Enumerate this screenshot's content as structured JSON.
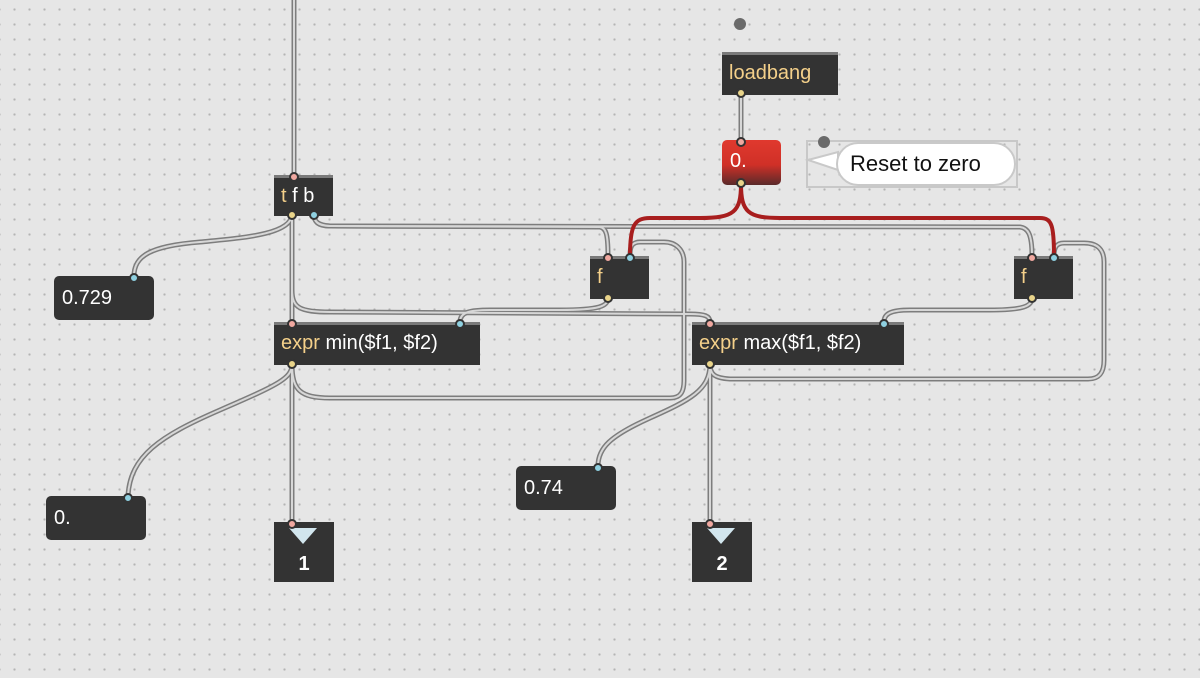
{
  "objects": {
    "trigger": {
      "class": "t",
      "args": "f b"
    },
    "loadbang": {
      "class": "loadbang"
    },
    "float_left": {
      "class": "f"
    },
    "float_right": {
      "class": "f"
    },
    "expr_min": {
      "class": "expr",
      "args": "min($f1, $f2)"
    },
    "expr_max": {
      "class": "expr",
      "args": "max($f1, $f2)"
    }
  },
  "message": {
    "text": "0."
  },
  "comment": {
    "text": "Reset to zero"
  },
  "number_boxes": {
    "input_value": "0.729",
    "min_value": "0.",
    "max_value": "0.74"
  },
  "outlets": {
    "out1": "1",
    "out2": "2"
  },
  "colors": {
    "canvas": "#e6e6e6",
    "object_bg": "#333333",
    "object_class_text": "#f4d08a",
    "patch_cord": "#9a9a9a",
    "message_red": "#d8332b",
    "red_cord": "#a81e1e"
  }
}
